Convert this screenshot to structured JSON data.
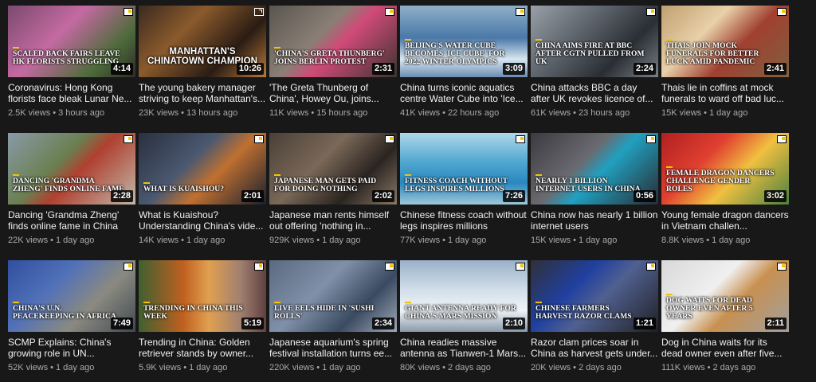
{
  "videos": [
    {
      "title": "Coronavirus: Hong Kong florists face bleak Lunar Ne...",
      "views": "2.5K views",
      "age": "3 hours ago",
      "duration": "4:14",
      "caption": "Scaled back fairs leave HK florists struggling",
      "thumb": "linear-gradient(135deg,#7b4a6e 0%,#c46aa2 40%,#4d6b3a 75%,#2f2a2a 100%)"
    },
    {
      "title": "The young bakery manager striving to keep Manhattan's...",
      "views": "23K views",
      "age": "13 hours ago",
      "duration": "10:26",
      "caption": "Manhattan's Chinatown Champion",
      "thumb": "linear-gradient(135deg,#3a2a20 0%,#8a5a2c 35%,#2a1c14 70%,#b97a3a 100%)"
    },
    {
      "title": "'The Greta Thunberg of China', Howey Ou, joins...",
      "views": "11K views",
      "age": "15 hours ago",
      "duration": "2:31",
      "caption": "'China's Greta Thunberg' joins Berlin protest",
      "thumb": "linear-gradient(135deg,#5a5550 0%,#8a7f75 40%,#d04a78 55%,#3a3530 100%)"
    },
    {
      "title": "China turns iconic aquatics centre Water Cube into 'Ice...",
      "views": "41K views",
      "age": "22 hours ago",
      "duration": "3:09",
      "caption": "Beijing's Water Cube becomes 'Ice Cube' for 2022 Winter Olympics",
      "thumb": "linear-gradient(180deg,#8fb0c8 0%,#4a78a8 45%,#d8e6f0 75%,#6a8cb0 100%)"
    },
    {
      "title": "China attacks BBC a day after UK revokes licence of...",
      "views": "61K views",
      "age": "23 hours ago",
      "duration": "2:24",
      "caption": "China aims fire at BBC after CGTN pulled from UK",
      "thumb": "linear-gradient(135deg,#9aa0a8 0%,#5a6068 40%,#2a2e34 70%,#7a7f86 100%)"
    },
    {
      "title": "Thais lie in coffins at mock funerals to ward off bad luc...",
      "views": "15K views",
      "age": "1 day ago",
      "duration": "2:41",
      "caption": "Thais join mock funerals for better luck amid pandemic",
      "thumb": "linear-gradient(135deg,#c0a070 0%,#e8d0a8 35%,#a04030 60%,#806040 100%)"
    },
    {
      "title": "Dancing 'Grandma Zheng' finds online fame in China",
      "views": "22K views",
      "age": "1 day ago",
      "duration": "2:28",
      "caption": "Dancing 'Grandma Zheng' finds online fame",
      "thumb": "linear-gradient(135deg,#8a9aa8 0%,#6a8050 40%,#b04030 55%,#c0b8a8 100%)"
    },
    {
      "title": "What is Kuaishou? Understanding China's vide...",
      "views": "14K views",
      "age": "1 day ago",
      "duration": "2:01",
      "caption": "What is Kuaishou?",
      "thumb": "linear-gradient(135deg,#2a3040 0%,#4a5870 40%,#c07030 60%,#1a2030 100%)"
    },
    {
      "title": "Japanese man rents himself out offering 'nothing in...",
      "views": "929K views",
      "age": "1 day ago",
      "duration": "2:02",
      "caption": "Japanese man gets paid for doing nothing",
      "thumb": "linear-gradient(135deg,#4a4038 0%,#7a6858 40%,#2a2420 70%,#8a7868 100%)"
    },
    {
      "title": "Chinese fitness coach without legs inspires millions",
      "views": "77K views",
      "age": "1 day ago",
      "duration": "7:26",
      "caption": "Fitness coach without legs inspires millions",
      "thumb": "linear-gradient(180deg,#b0d8e8 0%,#50a8d0 40%,#2a88c0 70%,#a0c8d8 100%)"
    },
    {
      "title": "China now has nearly 1 billion internet users",
      "views": "15K views",
      "age": "1 day ago",
      "duration": "0:56",
      "caption": "Nearly 1 billion internet users in China",
      "thumb": "linear-gradient(135deg,#3a3a40 0%,#6a6a70 40%,#20a0c0 55%,#2a2a30 100%)"
    },
    {
      "title": "Young female dragon dancers in Vietnam challen...",
      "views": "8.8K views",
      "age": "1 day ago",
      "duration": "3:02",
      "caption": "Female dragon dancers challenge gender roles",
      "thumb": "linear-gradient(135deg,#b02020 0%,#e04030 35%,#f0c040 60%,#4a8040 100%)"
    },
    {
      "title": "SCMP Explains: China's growing role in UN...",
      "views": "52K views",
      "age": "1 day ago",
      "duration": "7:49",
      "caption": "China's U.N. peacekeeping in Africa",
      "thumb": "linear-gradient(135deg,#3050a0 0%,#5070b8 35%,#8a8a80 65%,#404850 100%)"
    },
    {
      "title": "Trending in China: Golden retriever stands by owner...",
      "views": "5.9K views",
      "age": "1 day ago",
      "duration": "5:19",
      "caption": "Trending in China this week",
      "thumb": "linear-gradient(90deg,#406030 0%,#c06020 35%,#e0a050 55%,#a08070 80%,#604040 100%)"
    },
    {
      "title": "Japanese aquarium's spring festival installation turns ee...",
      "views": "220K views",
      "age": "1 day ago",
      "duration": "2:34",
      "caption": "Live eels hide in 'sushi rolls'",
      "thumb": "linear-gradient(135deg,#5a6a80 0%,#8090a8 40%,#3a4a60 70%,#a0a8b8 100%)"
    },
    {
      "title": "China readies massive antenna as Tianwen-1 Mars...",
      "views": "80K views",
      "age": "2 days ago",
      "duration": "2:10",
      "caption": "Giant antenna ready for China's Mars mission",
      "thumb": "linear-gradient(180deg,#9ab0c8 0%,#d0dde8 40%,#f0f4f8 70%,#8898a8 100%)"
    },
    {
      "title": "Razor clam prices soar in China as harvest gets under...",
      "views": "20K views",
      "age": "2 days ago",
      "duration": "1:21",
      "caption": "Chinese farmers harvest razor clams",
      "thumb": "linear-gradient(135deg,#303038 0%,#2040a0 35%,#506090 55%,#202024 100%)"
    },
    {
      "title": "Dog in China waits for its dead owner even after five...",
      "views": "111K views",
      "age": "2 days ago",
      "duration": "2:11",
      "caption": "Dog waits for dead owner even after 5 years",
      "thumb": "linear-gradient(135deg,#d8d8d8 0%,#f0f0f0 40%,#c89050 60%,#a0a0a0 100%)"
    }
  ]
}
